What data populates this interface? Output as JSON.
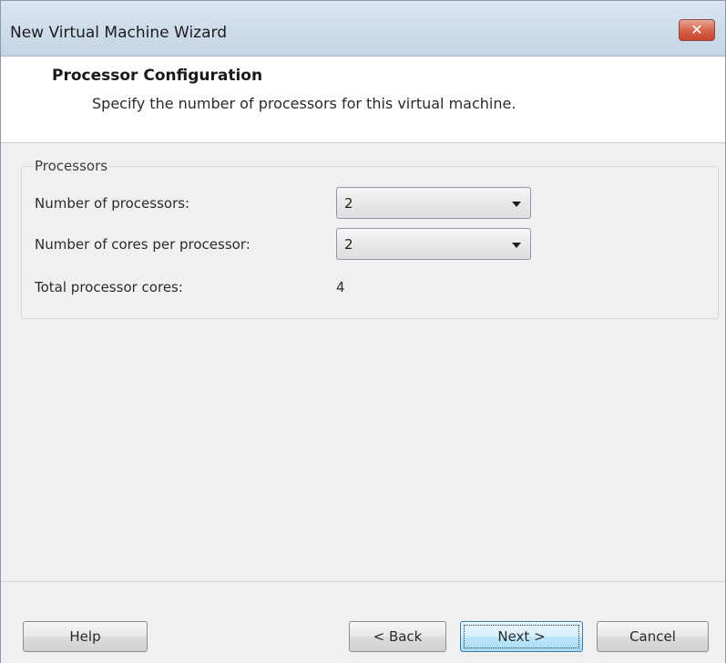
{
  "window": {
    "title": "New Virtual Machine Wizard",
    "close_glyph": "✕"
  },
  "header": {
    "title": "Processor Configuration",
    "subtitle": "Specify the number of processors for this virtual machine."
  },
  "processors": {
    "group_label": "Processors",
    "num_processors_label": "Number of processors:",
    "num_processors_value": "2",
    "cores_per_processor_label": "Number of cores per processor:",
    "cores_per_processor_value": "2",
    "total_cores_label": "Total processor cores:",
    "total_cores_value": "4"
  },
  "footer": {
    "help_label": "Help",
    "back_label": "< Back",
    "next_label": "Next >",
    "cancel_label": "Cancel"
  },
  "icons": {
    "close": "close-icon",
    "dropdown": "chevron-down-icon"
  },
  "colors": {
    "close_button": "#d8644d",
    "default_button_border": "#3c7fb1",
    "header_background": "#ffffff",
    "dialog_background": "#f0f0f0"
  }
}
